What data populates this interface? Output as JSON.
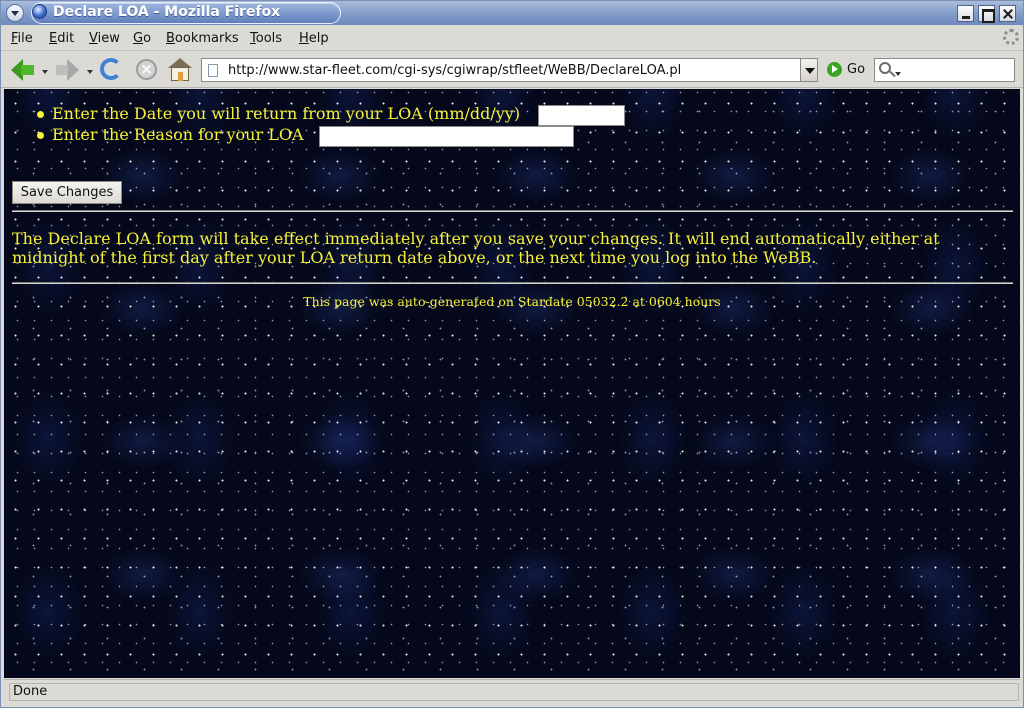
{
  "window": {
    "title": "Declare LOA - Mozilla Firefox"
  },
  "menu": {
    "items": [
      {
        "label_ul": "F",
        "label_rest": "ile"
      },
      {
        "label_ul": "E",
        "label_rest": "dit"
      },
      {
        "label_ul": "V",
        "label_rest": "iew"
      },
      {
        "label_ul": "G",
        "label_rest": "o"
      },
      {
        "label_ul": "B",
        "label_rest": "ookmarks"
      },
      {
        "label_ul": "T",
        "label_rest": "ools"
      },
      {
        "label_ul": "H",
        "label_rest": "elp"
      }
    ]
  },
  "toolbar": {
    "url": "http://www.star-fleet.com/cgi-sys/cgiwrap/stfleet/WeBB/DeclareLOA.pl",
    "go_label": "Go",
    "search_value": ""
  },
  "page": {
    "form": {
      "date_label": "Enter the Date you will return from your LOA (mm/dd/yy)",
      "date_value": "",
      "reason_label": "Enter the Reason for your LOA",
      "reason_value": "",
      "save_label": "Save Changes"
    },
    "notice": "The Declare LOA form will take effect immediately after you save your changes. It will end automatically either at midnight of the first day after your LOA return date above, or the next time you log into the WeBB.",
    "footer": "This page was auto-generated on Stardate 05032.2 at 0604 hours",
    "text_color": "#f7f13a",
    "background_color": "#04081a"
  },
  "status": {
    "text": "Done"
  }
}
